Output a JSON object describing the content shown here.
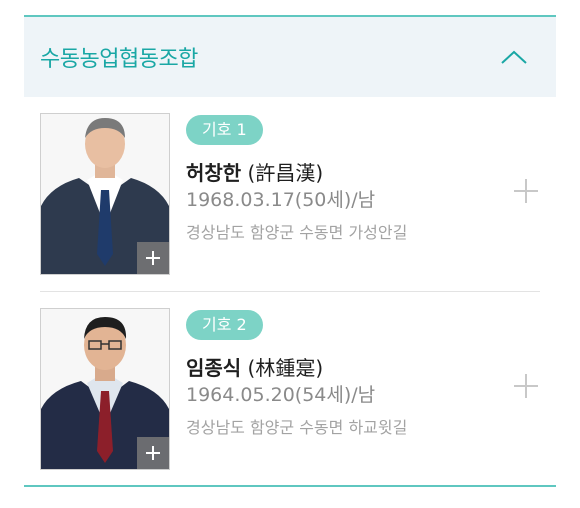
{
  "section": {
    "title": "수동농업협동조합",
    "collapse_icon": "chevron-up-icon",
    "accent_color": "#1aa7a5"
  },
  "candidates": [
    {
      "badge": "기호 1",
      "name": "허창한",
      "hanja": " (許昌漢)",
      "birth": "1968.03.17(50세)/남",
      "address": "경상남도 함양군 수동면 가성안길",
      "photo_plus_icon": "plus-icon",
      "expand_icon": "plus-icon"
    },
    {
      "badge": "기호 2",
      "name": "임종식",
      "hanja": " (林鍾寔)",
      "birth": "1964.05.20(54세)/남",
      "address": "경상남도 함양군 수동면 하교윗길",
      "photo_plus_icon": "plus-icon",
      "expand_icon": "plus-icon"
    }
  ],
  "colors": {
    "badge_bg": "#7dd3c6",
    "rule": "#5fc7c0",
    "header_bg": "#eef4f8"
  }
}
